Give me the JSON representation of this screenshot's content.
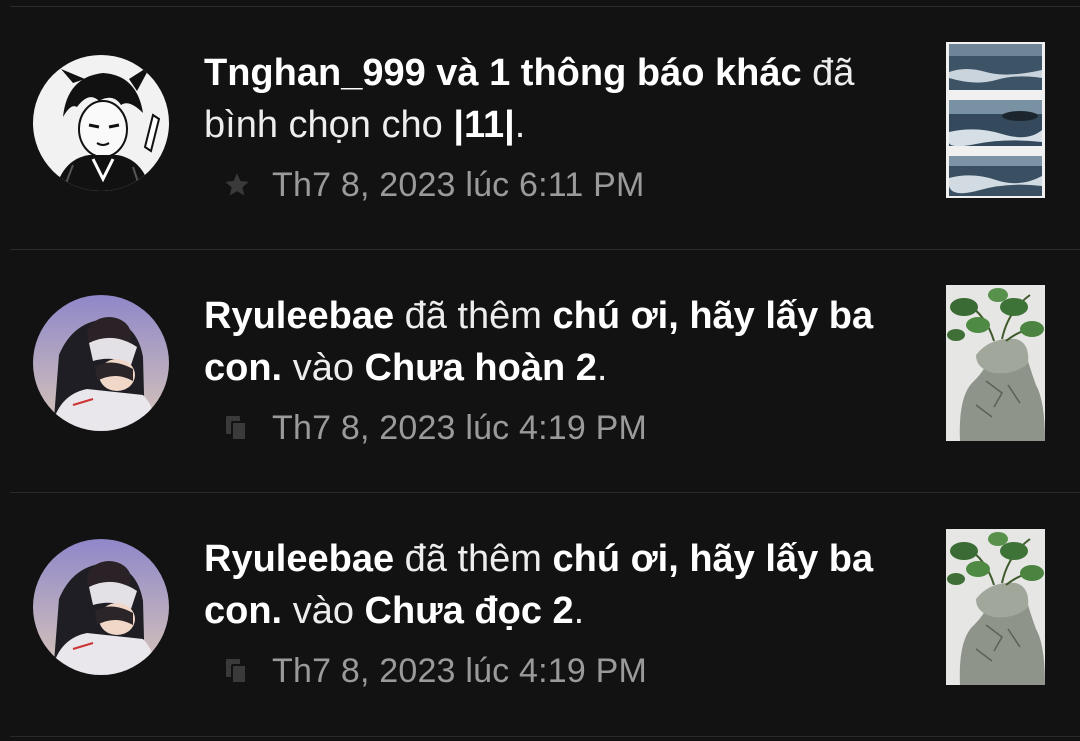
{
  "notifications": [
    {
      "actor": "Tnghan_999 và 1 thông báo khác",
      "verb": "đã",
      "action_tail": "bình chọn cho",
      "target": "|11|",
      "punct": ".",
      "timestamp": "Th7 8, 2023 lúc 6:11 PM",
      "type_icon": "star-icon",
      "avatar_icon": "manga-boy-avatar",
      "thumbnail_icon": "ocean-waves-thumbnail"
    },
    {
      "actor": "Ryuleebae",
      "verb": "đã thêm",
      "target": "chú ơi, hãy lấy ba con.",
      "connector": "vào",
      "list": "Chưa hoàn 2",
      "punct": ".",
      "timestamp": "Th7 8, 2023 lúc 4:19 PM",
      "type_icon": "library-add-icon",
      "avatar_icon": "couple-hug-avatar",
      "thumbnail_icon": "plant-bust-thumbnail"
    },
    {
      "actor": "Ryuleebae",
      "verb": "đã thêm",
      "target": "chú ơi, hãy lấy ba con.",
      "connector": "vào",
      "list": "Chưa đọc 2",
      "punct": ".",
      "timestamp": "Th7 8, 2023 lúc 4:19 PM",
      "type_icon": "library-add-icon",
      "avatar_icon": "couple-hug-avatar",
      "thumbnail_icon": "plant-bust-thumbnail"
    }
  ],
  "colors": {
    "background": "#121212",
    "divider": "#2a2a2a",
    "primary_text": "#ffffff",
    "secondary_text": "#9a9a9a",
    "icon": "#3a3a3a"
  }
}
